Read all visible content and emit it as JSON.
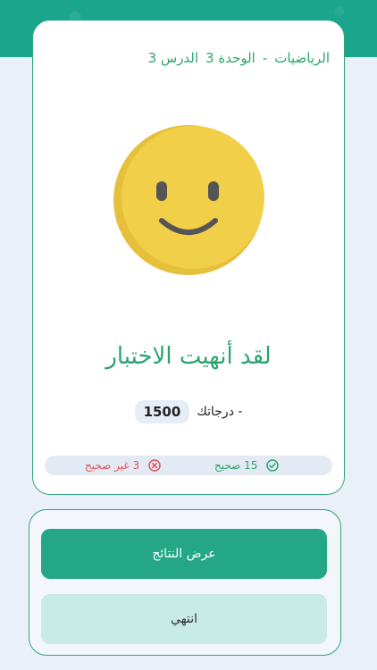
{
  "header": {
    "subject": "الرياضيات",
    "separator": "-",
    "unit": "الوحدة 3",
    "lesson": "الدرس 3"
  },
  "result": {
    "title": "لقد أنهيت الاختبار",
    "score_value": "1500",
    "score_label": "- درجاتك"
  },
  "stats": {
    "correct_text": "15 صحيح",
    "wrong_text": "3 غير صحيح"
  },
  "actions": {
    "view_results_label": "عرض النتائج",
    "finish_label": "انتهي"
  },
  "colors": {
    "primary": "#24a785",
    "accent_text": "#2ba46f",
    "error": "#e2545a",
    "smiley_face": "#f2cf48"
  }
}
